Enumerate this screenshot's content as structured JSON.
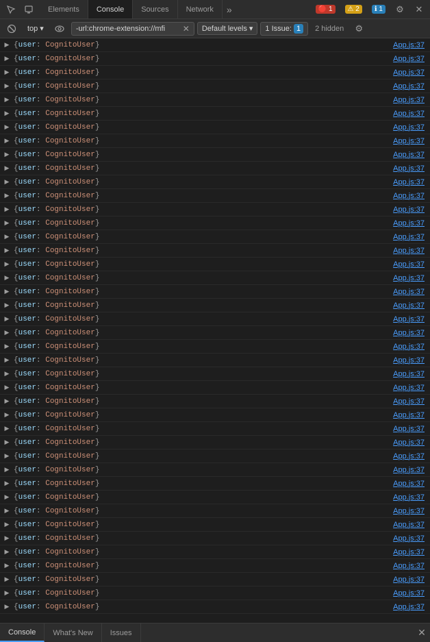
{
  "tabs": [
    {
      "label": "Elements",
      "active": false
    },
    {
      "label": "Console",
      "active": true
    },
    {
      "label": "Sources",
      "active": false
    },
    {
      "label": "Network",
      "active": false
    }
  ],
  "toolbar_icons": {
    "more": "»",
    "error_badge": "🔴 1",
    "warning_badge": "⚠ 2",
    "info_badge": "ℹ 1",
    "settings": "⚙",
    "close": "✕"
  },
  "second_toolbar": {
    "clear_label": "🚫",
    "filter_label": "top",
    "eye_label": "👁",
    "url_filter": "-url:chrome-extension://mfi",
    "levels_label": "Default levels",
    "issue_label": "1 Issue:",
    "issue_badge": "1",
    "hidden_label": "2 hidden",
    "settings_icon": "⚙"
  },
  "console_rows": [
    {
      "content": "▶ {user: CognitoUser}",
      "source": "App.js:37"
    },
    {
      "content": "▶ {user: CognitoUser}",
      "source": "App.js:37"
    },
    {
      "content": "▶ {user: CognitoUser}",
      "source": "App.js:37"
    },
    {
      "content": "▶ {user: CognitoUser}",
      "source": "App.js:37"
    },
    {
      "content": "▶ {user: CognitoUser}",
      "source": "App.js:37"
    },
    {
      "content": "▶ {user: CognitoUser}",
      "source": "App.js:37"
    },
    {
      "content": "▶ {user: CognitoUser}",
      "source": "App.js:37"
    },
    {
      "content": "▶ {user: CognitoUser}",
      "source": "App.js:37"
    },
    {
      "content": "▶ {user: CognitoUser}",
      "source": "App.js:37"
    },
    {
      "content": "▶ {user: CognitoUser}",
      "source": "App.js:37"
    },
    {
      "content": "▶ {user: CognitoUser}",
      "source": "App.js:37"
    },
    {
      "content": "▶ {user: CognitoUser}",
      "source": "App.js:37"
    },
    {
      "content": "▶ {user: CognitoUser}",
      "source": "App.js:37"
    },
    {
      "content": "▶ {user: CognitoUser}",
      "source": "App.js:37"
    },
    {
      "content": "▶ {user: CognitoUser}",
      "source": "App.js:37"
    },
    {
      "content": "▶ {user: CognitoUser}",
      "source": "App.js:37"
    },
    {
      "content": "▶ {user: CognitoUser}",
      "source": "App.js:37"
    },
    {
      "content": "▶ {user: CognitoUser}",
      "source": "App.js:37"
    },
    {
      "content": "▶ {user: CognitoUser}",
      "source": "App.js:37"
    },
    {
      "content": "▶ {user: CognitoUser}",
      "source": "App.js:37"
    },
    {
      "content": "▶ {user: CognitoUser}",
      "source": "App.js:37"
    },
    {
      "content": "▶ {user: CognitoUser}",
      "source": "App.js:37"
    },
    {
      "content": "▶ {user: CognitoUser}",
      "source": "App.js:37"
    },
    {
      "content": "▶ {user: CognitoUser}",
      "source": "App.js:37"
    },
    {
      "content": "▶ {user: CognitoUser}",
      "source": "App.js:37"
    },
    {
      "content": "▶ {user: CognitoUser}",
      "source": "App.js:37"
    },
    {
      "content": "▶ {user: CognitoUser}",
      "source": "App.js:37"
    },
    {
      "content": "▶ {user: CognitoUser}",
      "source": "App.js:37"
    },
    {
      "content": "▶ {user: CognitoUser}",
      "source": "App.js:37"
    },
    {
      "content": "▶ {user: CognitoUser}",
      "source": "App.js:37"
    },
    {
      "content": "▶ {user: CognitoUser}",
      "source": "App.js:37"
    },
    {
      "content": "▶ {user: CognitoUser}",
      "source": "App.js:37"
    },
    {
      "content": "▶ {user: CognitoUser}",
      "source": "App.js:37"
    },
    {
      "content": "▶ {user: CognitoUser}",
      "source": "App.js:37"
    },
    {
      "content": "▶ {user: CognitoUser}",
      "source": "App.js:37"
    },
    {
      "content": "▶ {user: CognitoUser}",
      "source": "App.js:37"
    },
    {
      "content": "▶ {user: CognitoUser}",
      "source": "App.js:37"
    },
    {
      "content": "▶ {user: CognitoUser}",
      "source": "App.js:37"
    },
    {
      "content": "▶ {user: CognitoUser}",
      "source": "App.js:37"
    },
    {
      "content": "▶ {user: CognitoUser}",
      "source": "App.js:37"
    },
    {
      "content": "▶ {user: CognitoUser}",
      "source": "App.js:37"
    },
    {
      "content": "▶ {user: CognitoUser}",
      "source": "App.js:37"
    }
  ],
  "bottom_tabs": [
    {
      "label": "Console",
      "active": true
    },
    {
      "label": "What's New",
      "active": false
    },
    {
      "label": "Issues",
      "active": false
    }
  ]
}
